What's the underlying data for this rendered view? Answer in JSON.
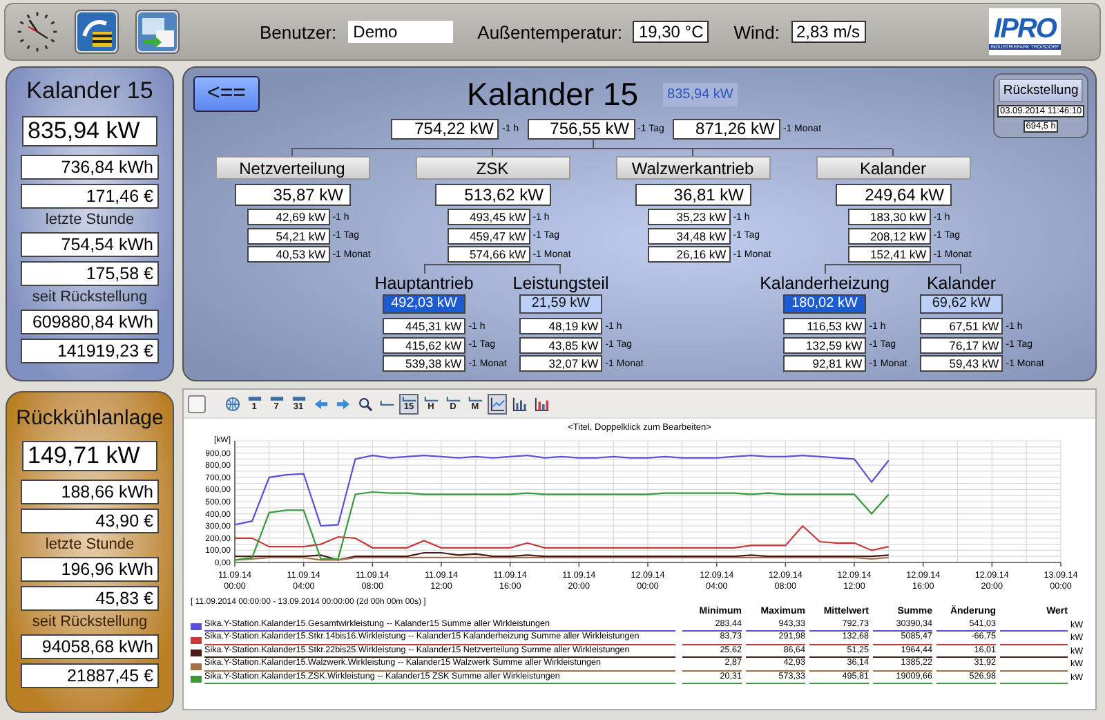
{
  "header": {
    "fields": [
      {
        "label": "Benutzer:",
        "value": "Demo",
        "kind": "input"
      },
      {
        "label": "Außentemperatur:",
        "value": "19,30 °C",
        "kind": "display"
      },
      {
        "label": "Wind:",
        "value": "2,83 m/s",
        "kind": "display"
      }
    ],
    "logo": {
      "text": "IPRO",
      "subtitle": "INDUSTRIEPARK TROISDORF"
    }
  },
  "side_panels": [
    {
      "title": "Kalander 15",
      "color": "#7f8fbf",
      "items": [
        {
          "kind": "main",
          "text": "835,94 kW"
        },
        {
          "kind": "value",
          "text": "736,84 kWh"
        },
        {
          "kind": "value",
          "text": "171,46 €"
        },
        {
          "kind": "label",
          "text": "letzte Stunde"
        },
        {
          "kind": "value",
          "text": "754,54 kWh"
        },
        {
          "kind": "value",
          "text": "175,58 €"
        },
        {
          "kind": "label",
          "text": "seit Rückstellung"
        },
        {
          "kind": "value",
          "text": "609880,84 kWh"
        },
        {
          "kind": "value",
          "text": "141919,23 €"
        }
      ]
    },
    {
      "title": "Rückkühlanlage",
      "color": "#b97f22",
      "items": [
        {
          "kind": "main",
          "text": "149,71 kW"
        },
        {
          "kind": "value",
          "text": "188,66 kWh"
        },
        {
          "kind": "value",
          "text": "43,90 €"
        },
        {
          "kind": "label",
          "text": "letzte Stunde"
        },
        {
          "kind": "value",
          "text": "196,96 kWh"
        },
        {
          "kind": "value",
          "text": "45,83 €"
        },
        {
          "kind": "label",
          "text": "seit Rückstellung"
        },
        {
          "kind": "value",
          "text": "94058,68 kWh"
        },
        {
          "kind": "value",
          "text": "21887,45 €"
        }
      ]
    }
  ],
  "overview": {
    "back_button": "<==",
    "title": "Kalander 15",
    "badge": "835,94 kW",
    "totals": [
      {
        "value": "754,22 kW",
        "label": "-1 h"
      },
      {
        "value": "756,55 kW",
        "label": "-1 Tag"
      },
      {
        "value": "871,26 kW",
        "label": "-1 Monat"
      }
    ],
    "reset": {
      "button": "Rückstellung",
      "date": "03.09.2014 11:46:10",
      "hours": "694,5 h"
    },
    "groups": [
      {
        "name": "Netzverteilung",
        "value": "35,87 kW",
        "history": [
          {
            "value": "42,69 kW",
            "label": "-1 h"
          },
          {
            "value": "54,21 kW",
            "label": "-1 Tag"
          },
          {
            "value": "40,53 kW",
            "label": "-1 Monat"
          }
        ]
      },
      {
        "name": "ZSK",
        "value": "513,62 kW",
        "history": [
          {
            "value": "493,45 kW",
            "label": "-1 h"
          },
          {
            "value": "459,47 kW",
            "label": "-1 Tag"
          },
          {
            "value": "574,66 kW",
            "label": "-1 Monat"
          }
        ],
        "children": [
          {
            "name": "Hauptantrieb",
            "value": "492,03 kW",
            "color": "#1d5bd0",
            "history": [
              {
                "value": "445,31 kW",
                "label": "-1 h"
              },
              {
                "value": "415,62 kW",
                "label": "-1 Tag"
              },
              {
                "value": "539,38 kW",
                "label": "-1 Monat"
              }
            ]
          },
          {
            "name": "Leistungsteil",
            "value": "21,59 kW",
            "color": "#bcd0f7",
            "history": [
              {
                "value": "48,19 kW",
                "label": "-1 h"
              },
              {
                "value": "43,85 kW",
                "label": "-1 Tag"
              },
              {
                "value": "32,07 kW",
                "label": "-1 Monat"
              }
            ]
          }
        ]
      },
      {
        "name": "Walzwerkantrieb",
        "value": "36,81 kW",
        "history": [
          {
            "value": "35,23 kW",
            "label": "-1 h"
          },
          {
            "value": "34,48 kW",
            "label": "-1 Tag"
          },
          {
            "value": "26,16 kW",
            "label": "-1 Monat"
          }
        ]
      },
      {
        "name": "Kalander",
        "value": "249,64 kW",
        "history": [
          {
            "value": "183,30 kW",
            "label": "-1 h"
          },
          {
            "value": "208,12 kW",
            "label": "-1 Tag"
          },
          {
            "value": "152,41 kW",
            "label": "-1 Monat"
          }
        ],
        "children": [
          {
            "name": "Kalanderheizung",
            "value": "180,02 kW",
            "color": "#1d5bd0",
            "history": [
              {
                "value": "116,53 kW",
                "label": "-1 h"
              },
              {
                "value": "132,59 kW",
                "label": "-1 Tag"
              },
              {
                "value": "92,81 kW",
                "label": "-1 Monat"
              }
            ]
          },
          {
            "name": "Kalander",
            "value": "69,62 kW",
            "color": "#bcd0f7",
            "history": [
              {
                "value": "67,51 kW",
                "label": "-1 h"
              },
              {
                "value": "76,17 kW",
                "label": "-1 Tag"
              },
              {
                "value": "59,43 kW",
                "label": "-1 Monat"
              }
            ]
          }
        ]
      }
    ]
  },
  "chart_panel": {
    "toolbar": [
      {
        "kind": "blank"
      },
      {
        "kind": "globe"
      },
      {
        "kind": "calendar",
        "label": "1"
      },
      {
        "kind": "calendar",
        "label": "7"
      },
      {
        "kind": "calendar",
        "label": "31"
      },
      {
        "kind": "prev"
      },
      {
        "kind": "next"
      },
      {
        "kind": "zoom"
      },
      {
        "kind": "period",
        "selected": false
      },
      {
        "kind": "period",
        "label": "15",
        "selected": true
      },
      {
        "kind": "period",
        "label": "H",
        "selected": false
      },
      {
        "kind": "period",
        "label": "D",
        "selected": false
      },
      {
        "kind": "period",
        "label": "M",
        "selected": false
      },
      {
        "kind": "line-chart",
        "selected": true
      },
      {
        "kind": "bar-chart",
        "selected": false
      },
      {
        "kind": "stacked-chart",
        "selected": false
      }
    ],
    "chart_data": {
      "type": "line",
      "title": "<Titel, Doppelklick zum Bearbeiten>",
      "ylabel": "[kW]",
      "grid": true,
      "categories": [
        "11.09.14 00:00",
        null,
        null,
        null,
        "11.09.14 04:00",
        null,
        null,
        null,
        "11.09.14 08:00",
        null,
        null,
        null,
        "11.09.14 12:00",
        null,
        null,
        null,
        "11.09.14 16:00",
        null,
        null,
        null,
        "11.09.14 20:00",
        null,
        null,
        null,
        "12.09.14 00:00",
        null,
        null,
        null,
        "12.09.14 04:00",
        null,
        null,
        null,
        "12.09.14 08:00",
        null,
        null,
        null,
        "12.09.14 12:00",
        null,
        null,
        null,
        "12.09.14 16:00",
        null,
        null,
        null,
        "12.09.14 20:00",
        null,
        null,
        null,
        "13.09.14 00:00"
      ],
      "ylim": [
        0,
        1000
      ],
      "yticks": [
        {
          "value": 0,
          "label": "0,00"
        },
        {
          "value": 100,
          "label": "100,00"
        },
        {
          "value": 200,
          "label": "200,00"
        },
        {
          "value": 300,
          "label": "300,00"
        },
        {
          "value": 400,
          "label": "400,00"
        },
        {
          "value": 500,
          "label": "500,00"
        },
        {
          "value": 600,
          "label": "600,00"
        },
        {
          "value": 700,
          "label": "700,00"
        },
        {
          "value": 800,
          "label": "800,00"
        },
        {
          "value": 900,
          "label": "900,00"
        }
      ],
      "series": [
        {
          "name": "Sika.Y-Station.Kalander15.Gesamtwirkleistung  --  Kalander15  Summe aller Wirkleistungen",
          "color": "#5a4fd8",
          "values": [
            310,
            340,
            700,
            720,
            730,
            300,
            310,
            850,
            880,
            860,
            870,
            880,
            870,
            860,
            870,
            860,
            870,
            880,
            860,
            870,
            860,
            860,
            870,
            860,
            860,
            870,
            860,
            860,
            860,
            870,
            880,
            870,
            870,
            880,
            870,
            860,
            850,
            660,
            840,
            null,
            null,
            null,
            null,
            null,
            null,
            null,
            null,
            null,
            null
          ]
        },
        {
          "name": "Sika.Y-Station.Kalander15.Stkr.14bis16.Wirkleistung  --  Kalander15 Kalanderheizung  Summe aller Wirkleistungen",
          "color": "#c83a3a",
          "values": [
            200,
            200,
            130,
            130,
            130,
            150,
            210,
            200,
            120,
            120,
            120,
            180,
            120,
            120,
            120,
            120,
            120,
            160,
            120,
            120,
            120,
            120,
            120,
            120,
            120,
            120,
            120,
            120,
            120,
            120,
            140,
            140,
            140,
            300,
            170,
            160,
            160,
            100,
            130,
            null,
            null,
            null,
            null,
            null,
            null,
            null,
            null,
            null,
            null
          ]
        },
        {
          "name": "Sika.Y-Station.Kalander15.Stkr.22bis25.Wirkleistung  --  Kalander15 Netzverteilung  Summe aller Wirkleistungen",
          "color": "#4a1a14",
          "values": [
            50,
            50,
            50,
            50,
            50,
            60,
            20,
            50,
            50,
            50,
            50,
            80,
            80,
            60,
            70,
            50,
            50,
            60,
            50,
            50,
            50,
            50,
            50,
            50,
            50,
            50,
            50,
            50,
            50,
            50,
            60,
            50,
            50,
            50,
            50,
            50,
            50,
            50,
            60,
            null,
            null,
            null,
            null,
            null,
            null,
            null,
            null,
            null,
            null
          ]
        },
        {
          "name": "Sika.Y-Station.Kalander15.Walzwerk.Wirkleistung  --  Kalander15 Walzwerk  Summe aller Wirkleistungen",
          "color": "#a0704a",
          "values": [
            20,
            30,
            40,
            40,
            40,
            20,
            20,
            40,
            40,
            40,
            40,
            40,
            40,
            40,
            40,
            40,
            40,
            40,
            40,
            40,
            40,
            40,
            40,
            40,
            40,
            40,
            40,
            40,
            40,
            40,
            40,
            40,
            40,
            40,
            40,
            40,
            40,
            30,
            40,
            null,
            null,
            null,
            null,
            null,
            null,
            null,
            null,
            null,
            null
          ]
        },
        {
          "name": "Sika.Y-Station.Kalander15.ZSK.Wirkleistung  --  Kalander15 ZSK  Summe aller Wirkleistungen",
          "color": "#3a9a3a",
          "values": [
            20,
            40,
            410,
            430,
            430,
            30,
            30,
            560,
            580,
            570,
            570,
            560,
            560,
            560,
            560,
            560,
            560,
            570,
            560,
            560,
            560,
            560,
            560,
            560,
            560,
            570,
            570,
            570,
            570,
            570,
            560,
            570,
            560,
            560,
            560,
            560,
            560,
            400,
            560,
            null,
            null,
            null,
            null,
            null,
            null,
            null,
            null,
            null,
            null
          ]
        }
      ]
    },
    "range": "[ 11.09.2014 00:00:00  -  13.09.2014 00:00:00 (2d 00h 00m 00s) ]",
    "legend": {
      "headers": [
        "Minimum",
        "Maximum",
        "Mittelwert",
        "Summe",
        "Änderung",
        "Wert"
      ],
      "rows": [
        {
          "values": [
            "283,44",
            "943,33",
            "792,73",
            "30390,34",
            "541,03"
          ],
          "unit": "kW"
        },
        {
          "values": [
            "83,73",
            "291,98",
            "132,68",
            "5085,47",
            "-66,75"
          ],
          "unit": "kW"
        },
        {
          "values": [
            "25,62",
            "86,64",
            "51,25",
            "1964,44",
            "16,01"
          ],
          "unit": "kW"
        },
        {
          "values": [
            "2,87",
            "42,93",
            "36,14",
            "1385,22",
            "31,92"
          ],
          "unit": "kW"
        },
        {
          "values": [
            "20,31",
            "573,33",
            "495,81",
            "19009,66",
            "526,98"
          ],
          "unit": "kW"
        }
      ]
    }
  }
}
